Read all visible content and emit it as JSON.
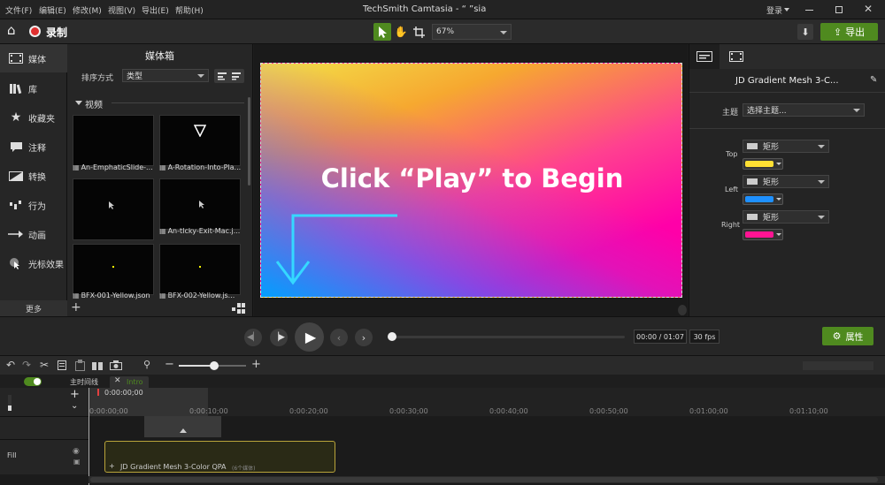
{
  "menubar": {
    "items": [
      "文件(F)",
      "编辑(E)",
      "修改(M)",
      "视图(V)",
      "导出(E)",
      "帮助(H)"
    ],
    "title": "TechSmith Camtasia - “    ”sia",
    "login": "登录"
  },
  "toolbar": {
    "record": "录制",
    "zoom": "67%",
    "export": "导出"
  },
  "nav": {
    "items": [
      "媒体",
      "库",
      "收藏夹",
      "注释",
      "转换",
      "行为",
      "动画",
      "光标效果"
    ],
    "more": "更多"
  },
  "mediabin": {
    "title": "媒体箱",
    "sort_label": "排序方式",
    "sort_value": "类型",
    "section": "视频",
    "items": [
      "An-EmphaticSlide-...",
      "A-Rotation-Into-Pla...",
      "",
      "An-tIcky-Exit-Mac.j...",
      "BFX-001-Yellow.json",
      "BFX-002-Yellow.js..."
    ]
  },
  "canvas": {
    "text": "Click “Play” to Begin"
  },
  "props": {
    "title": "JD Gradient Mesh 3-C...",
    "theme_label": "主题",
    "theme_value": "选择主题...",
    "rows": [
      {
        "label": "Top",
        "shape": "矩形",
        "color": "#ffe033"
      },
      {
        "label": "Left",
        "shape": "矩形",
        "color": "#1e90ff"
      },
      {
        "label": "Right",
        "shape": "矩形",
        "color": "#ff1493"
      }
    ]
  },
  "playback": {
    "time": "00:00 / 01:07",
    "fps": "30 fps",
    "props_btn": "属性",
    "progress": 0
  },
  "timeline": {
    "tab_main": "主时间线",
    "tab_intro": "Intro",
    "playhead": "0:00:00;00",
    "ticks": [
      "0:00:00;00",
      "0:00:10;00",
      "0:00:20;00",
      "0:00:30;00",
      "0:00:40;00",
      "0:00:50;00",
      "0:01:00;00",
      "0:01:10;00"
    ],
    "track": "Fill",
    "clip": "JD Gradient Mesh 3-Color QPA",
    "clip_sub": "(6个媒体)"
  }
}
